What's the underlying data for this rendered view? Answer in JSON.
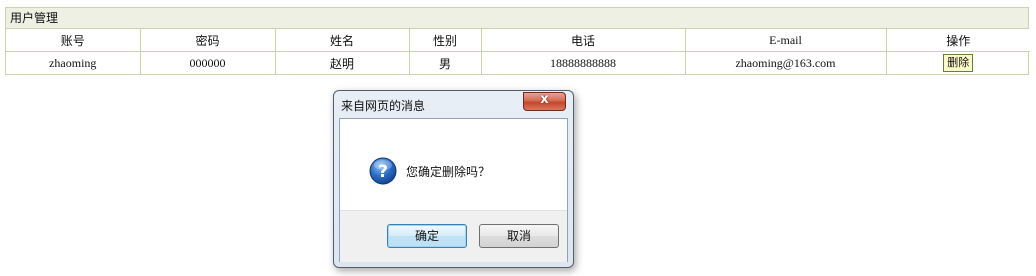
{
  "panel": {
    "title": "用户管理"
  },
  "table": {
    "headers": [
      "账号",
      "密码",
      "姓名",
      "性别",
      "电话",
      "E-mail",
      "操作"
    ],
    "rows": [
      {
        "account": "zhaoming",
        "password": "000000",
        "name": "赵明",
        "gender": "男",
        "phone": "18888888888",
        "email": "zhaoming@163.com",
        "action_label": "删除"
      }
    ]
  },
  "dialog": {
    "title": "来自网页的消息",
    "close_label": "x",
    "message": "您确定删除吗？",
    "ok_label": "确定",
    "cancel_label": "取消",
    "icon": "question-icon"
  },
  "colors": {
    "border": "#c9d3ad",
    "title_bg": "#edf0e3",
    "delete_bg": "#fafac8",
    "close_red": "#c7462b",
    "icon_blue": "#2a6cc4"
  }
}
